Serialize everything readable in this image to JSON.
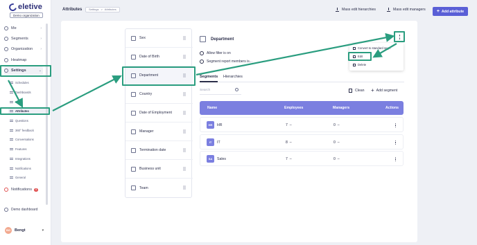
{
  "sidebar": {
    "logo": "eletive",
    "org": "Demo organization",
    "nav": [
      {
        "label": "Me"
      },
      {
        "label": "Segments"
      },
      {
        "label": "Organization"
      },
      {
        "label": "Heatmap"
      },
      {
        "label": "Settings"
      }
    ],
    "sub": [
      {
        "label": "Schedules"
      },
      {
        "label": "Dashboards"
      },
      {
        "label": "Users"
      },
      {
        "label": "Attributes"
      },
      {
        "label": "Questions"
      },
      {
        "label": "360° feedback"
      },
      {
        "label": "Conversations"
      },
      {
        "label": "Features"
      },
      {
        "label": "Integrations"
      },
      {
        "label": "Notifications"
      },
      {
        "label": "General"
      }
    ],
    "notifications": {
      "label": "Notifications",
      "count": "9"
    },
    "demo": "Demo dashboard",
    "user": {
      "initials": "BG",
      "name": "Bengt"
    }
  },
  "topbar": {
    "title": "Attributes",
    "breadcrumb": [
      "Settings",
      ">",
      "Attributes"
    ],
    "mass_hier": "Mass edit hierarchies",
    "mass_mgr": "Mass edit managers",
    "add": "Add attribute"
  },
  "attributes": [
    {
      "label": "Sex"
    },
    {
      "label": "Date of Birth"
    },
    {
      "label": "Department"
    },
    {
      "label": "Country"
    },
    {
      "label": "Date of Employment"
    },
    {
      "label": "Manager"
    },
    {
      "label": "Termination date"
    },
    {
      "label": "Business unit"
    },
    {
      "label": "Team"
    }
  ],
  "detail": {
    "title": "Department",
    "allow_filter": "Allow filter is on",
    "segment_report": "Segment report members is...",
    "dropdown": [
      "Convert to standard seg...",
      "Edit",
      "Delete"
    ],
    "tabs": [
      "Segments",
      "Hierarchies"
    ],
    "search_placeholder": "Search",
    "clean": "Clean",
    "add_segment": "Add segment",
    "columns": [
      "Name",
      "Employees",
      "Managers",
      "Actions"
    ],
    "rows": [
      {
        "code": "HR",
        "name": "HR",
        "employees": "7",
        "managers": "0"
      },
      {
        "code": "IT",
        "name": "IT",
        "employees": "8",
        "managers": "0"
      },
      {
        "code": "SA",
        "name": "Sales",
        "employees": "7",
        "managers": "0"
      }
    ],
    "dash": "–"
  },
  "colors": {
    "accent": "#5a5fd6",
    "highlight": "#2a9d7f",
    "table_header": "#7b7fe0"
  }
}
